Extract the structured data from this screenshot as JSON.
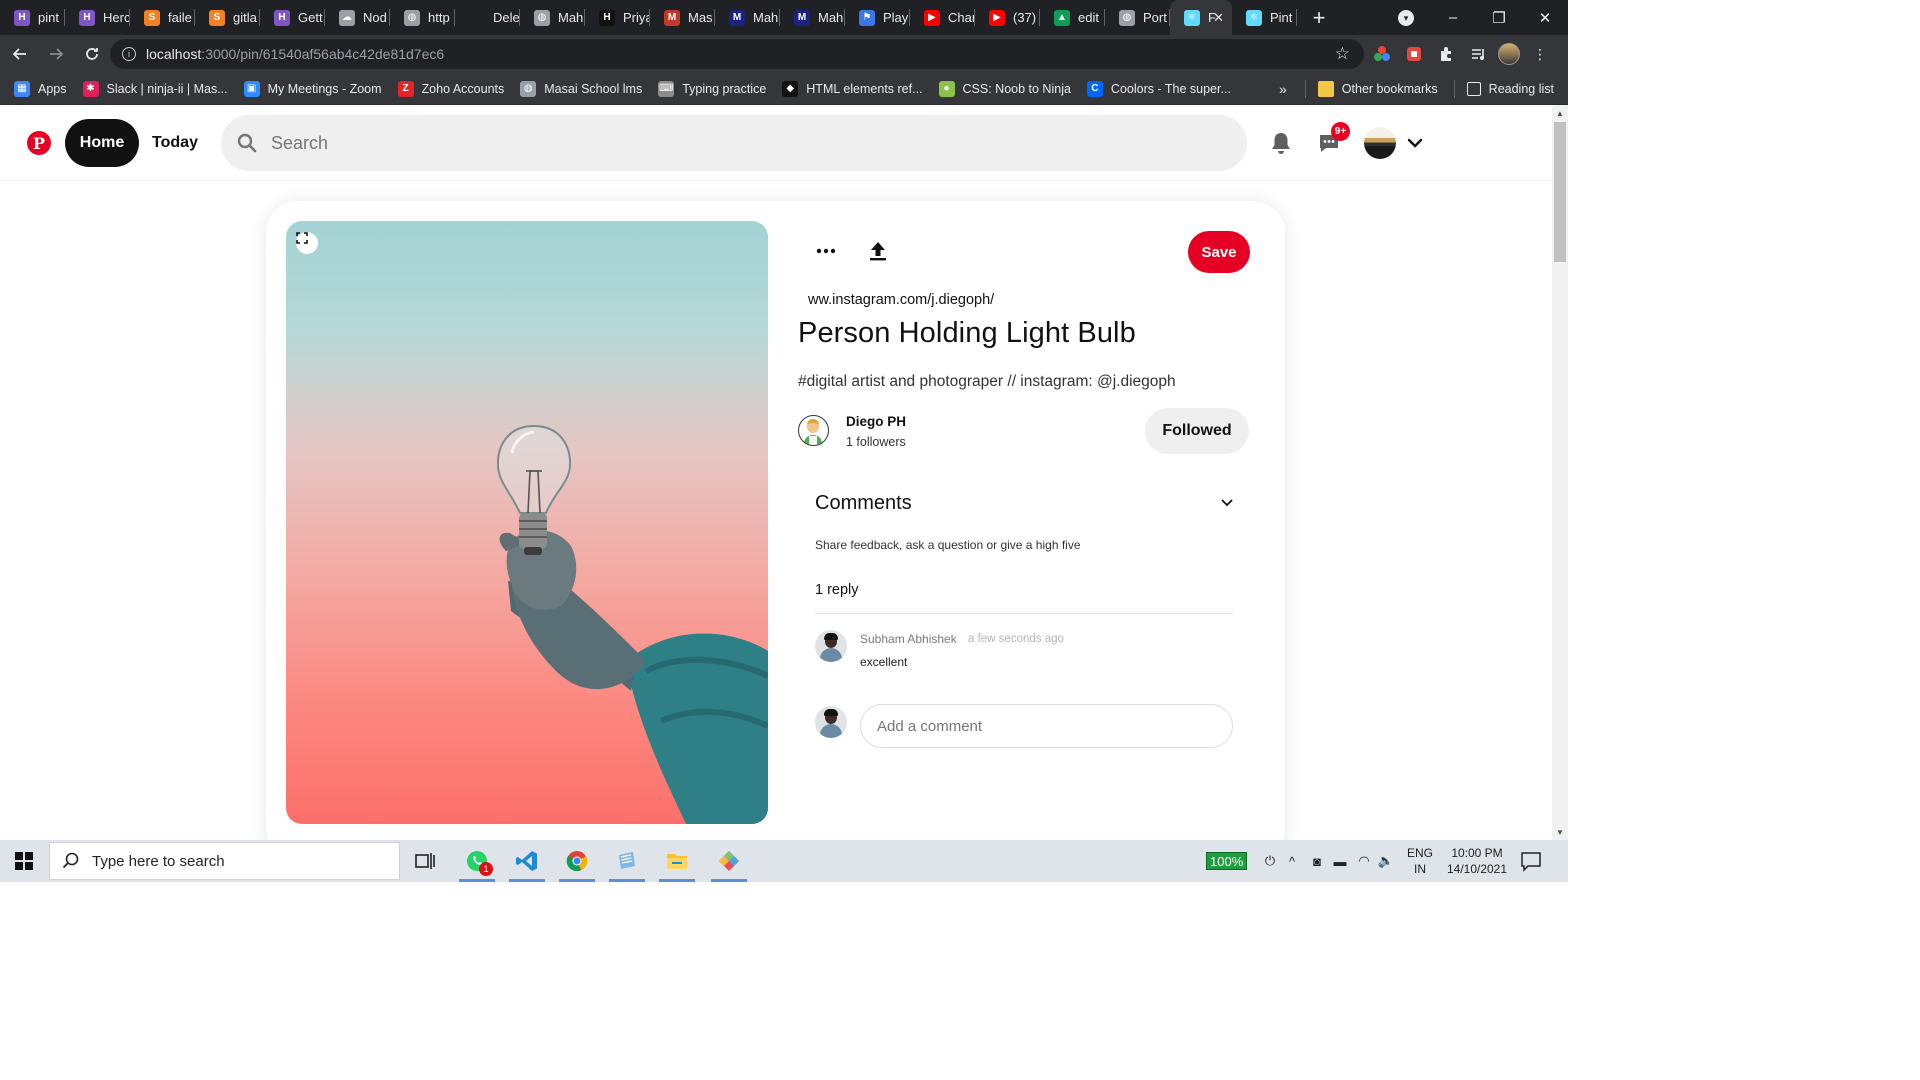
{
  "browser": {
    "tabs": [
      {
        "title": "pint",
        "icon": "H",
        "color": "#7e57c2"
      },
      {
        "title": "Herc",
        "icon": "H",
        "color": "#7e57c2"
      },
      {
        "title": "faile",
        "icon": "S",
        "color": "#f48024"
      },
      {
        "title": "gitla",
        "icon": "S",
        "color": "#f48024"
      },
      {
        "title": "Gett",
        "icon": "H",
        "color": "#7e57c2"
      },
      {
        "title": "Nod",
        "icon": "☁",
        "color": "#9aa0a6"
      },
      {
        "title": "http",
        "icon": "◍",
        "color": "#9aa0a6"
      },
      {
        "title": "Dele",
        "icon": "",
        "color": "#202124"
      },
      {
        "title": "Mah",
        "icon": "◍",
        "color": "#9aa0a6"
      },
      {
        "title": "Priya",
        "icon": "H",
        "color": "#111111"
      },
      {
        "title": "Mas",
        "icon": "M",
        "color": "#c0392b"
      },
      {
        "title": "Mah",
        "icon": "M",
        "color": "#1a237e"
      },
      {
        "title": "Mah",
        "icon": "M",
        "color": "#1a237e"
      },
      {
        "title": "Play",
        "icon": "⚑",
        "color": "#3b78e7"
      },
      {
        "title": "Char",
        "icon": "▶",
        "color": "#ff0000"
      },
      {
        "title": "(37)",
        "icon": "▶",
        "color": "#ff0000"
      },
      {
        "title": "edit",
        "icon": "▲",
        "color": "#0f9d58"
      },
      {
        "title": "Port",
        "icon": "◍",
        "color": "#9aa0a6"
      },
      {
        "title": "F",
        "icon": "⚛",
        "color": "#61dafb",
        "active": true
      },
      {
        "title": "Pint",
        "icon": "⚛",
        "color": "#61dafb"
      }
    ],
    "new_tab": "+",
    "window_controls": {
      "minimize": "–",
      "maximize": "❐",
      "close": "✕"
    },
    "url_host": "localhost",
    "url_path": ":3000/pin/61540af56ab4c42de81d7ec6",
    "bookmarks": [
      {
        "label": "Apps",
        "icon": "▦",
        "color": "#4285f4"
      },
      {
        "label": "Slack | ninja-ii | Mas...",
        "icon": "✱",
        "color": "#e01e5a"
      },
      {
        "label": "My Meetings - Zoom",
        "icon": "▣",
        "color": "#2d8cff"
      },
      {
        "label": "Zoho Accounts",
        "icon": "Z",
        "color": "#e42527"
      },
      {
        "label": "Masai School lms",
        "icon": "◍",
        "color": "#9aa0a6"
      },
      {
        "label": "Typing practice",
        "icon": "⌨",
        "color": "#8d8d8d"
      },
      {
        "label": "HTML elements ref...",
        "icon": "◆",
        "color": "#111111"
      },
      {
        "label": "CSS: Noob to Ninja",
        "icon": "●",
        "color": "#8bc34a"
      },
      {
        "label": "Coolors - The super...",
        "icon": "C",
        "color": "#0066ff"
      }
    ],
    "bookmarks_more": "»",
    "other_bookmarks": "Other bookmarks",
    "reading_list": "Reading list"
  },
  "header": {
    "logo": "P",
    "home_label": "Home",
    "today_label": "Today",
    "search_placeholder": "Search",
    "notification_badge": "9+"
  },
  "pin": {
    "source_link": "ww.instagram.com/j.diegoph/",
    "title": "Person Holding Light Bulb",
    "description": "#digital artist and photograper // instagram: @j.diegoph",
    "save_label": "Save",
    "creator": {
      "name": "Diego PH",
      "followers": "1 followers"
    },
    "follow_label": "Followed"
  },
  "comments": {
    "title": "Comments",
    "hint": "Share feedback, ask a question or give a high five",
    "reply_count": "1 reply",
    "items": [
      {
        "author": "Subham Abhishek",
        "time": "a few seconds ago",
        "text": "excellent"
      }
    ],
    "add_placeholder": "Add a comment"
  },
  "taskbar": {
    "search_placeholder": "Type here to search",
    "whatsapp_badge": "1",
    "battery": "100%",
    "lang_top": "ENG",
    "lang_bottom": "IN",
    "time": "10:00 PM",
    "date": "14/10/2021"
  },
  "colors": {
    "accent": "#e60023",
    "chrome_dark": "#202124",
    "chrome_toolbar": "#35363a"
  }
}
